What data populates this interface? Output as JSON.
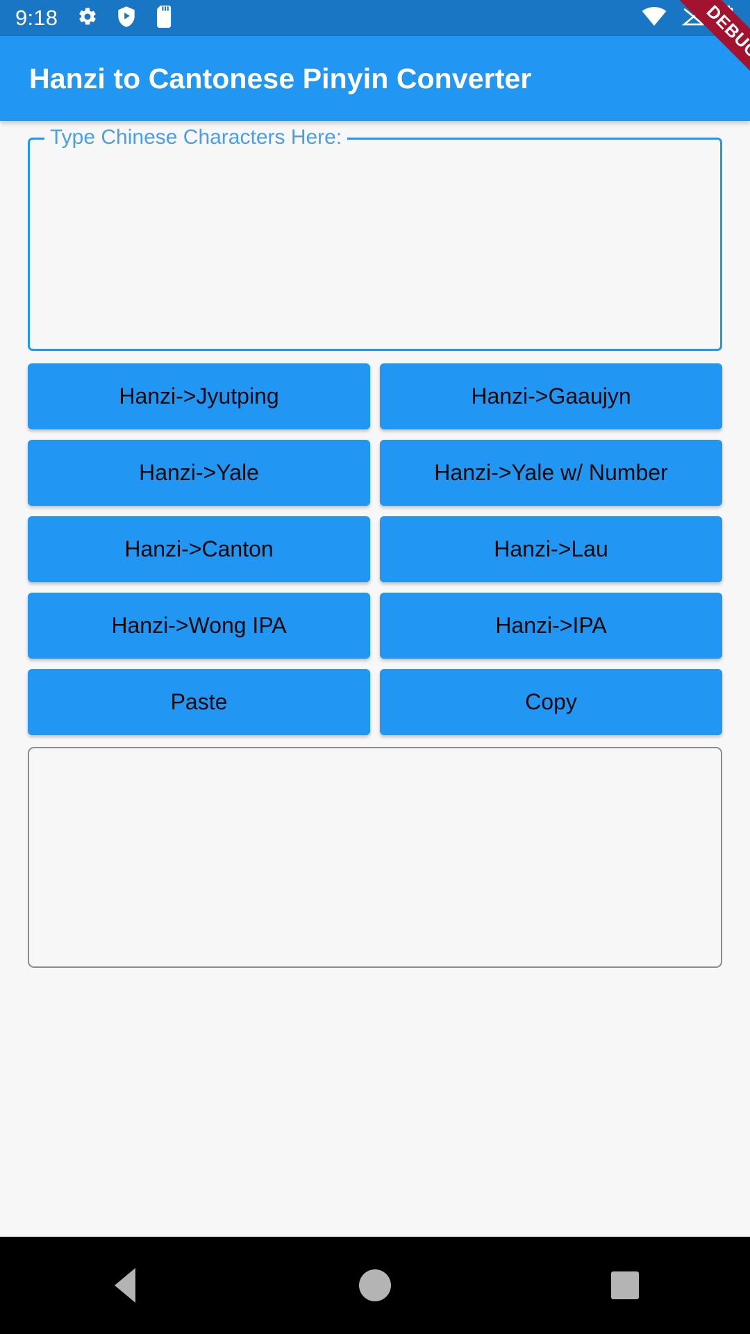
{
  "status_bar": {
    "time": "9:18",
    "left_icons": [
      "gear-icon",
      "shield-play-icon",
      "sd-card-icon"
    ],
    "right_icons": [
      "wifi-icon",
      "signal-off-icon",
      "battery-icon"
    ],
    "background_color": "#1976c5"
  },
  "debug_ribbon": {
    "label": "DEBUG",
    "color": "#a3132f"
  },
  "app_bar": {
    "title": "Hanzi to Cantonese Pinyin Converter",
    "background_color": "#2196f3",
    "text_color": "#ffffff"
  },
  "input_field": {
    "label": "Type Chinese Characters Here:",
    "value": "",
    "placeholder": "",
    "border_color": "#2196f3",
    "label_color": "#4a9fe8"
  },
  "buttons": {
    "accent_color": "#2196f3",
    "text_color": "#0a0a0a",
    "rows": [
      {
        "left": "Hanzi->Jyutping",
        "right": "Hanzi->Gaaujyn"
      },
      {
        "left": "Hanzi->Yale",
        "right": "Hanzi->Yale w/ Number"
      },
      {
        "left": "Hanzi->Canton",
        "right": "Hanzi->Lau"
      },
      {
        "left": "Hanzi->Wong IPA",
        "right": "Hanzi->IPA"
      },
      {
        "left": "Paste",
        "right": "Copy"
      }
    ]
  },
  "output_field": {
    "value": "",
    "border_color": "#8c8c8c"
  },
  "nav_bar": {
    "background_color": "#000000",
    "items": [
      "back-icon",
      "home-icon",
      "recents-icon"
    ]
  }
}
